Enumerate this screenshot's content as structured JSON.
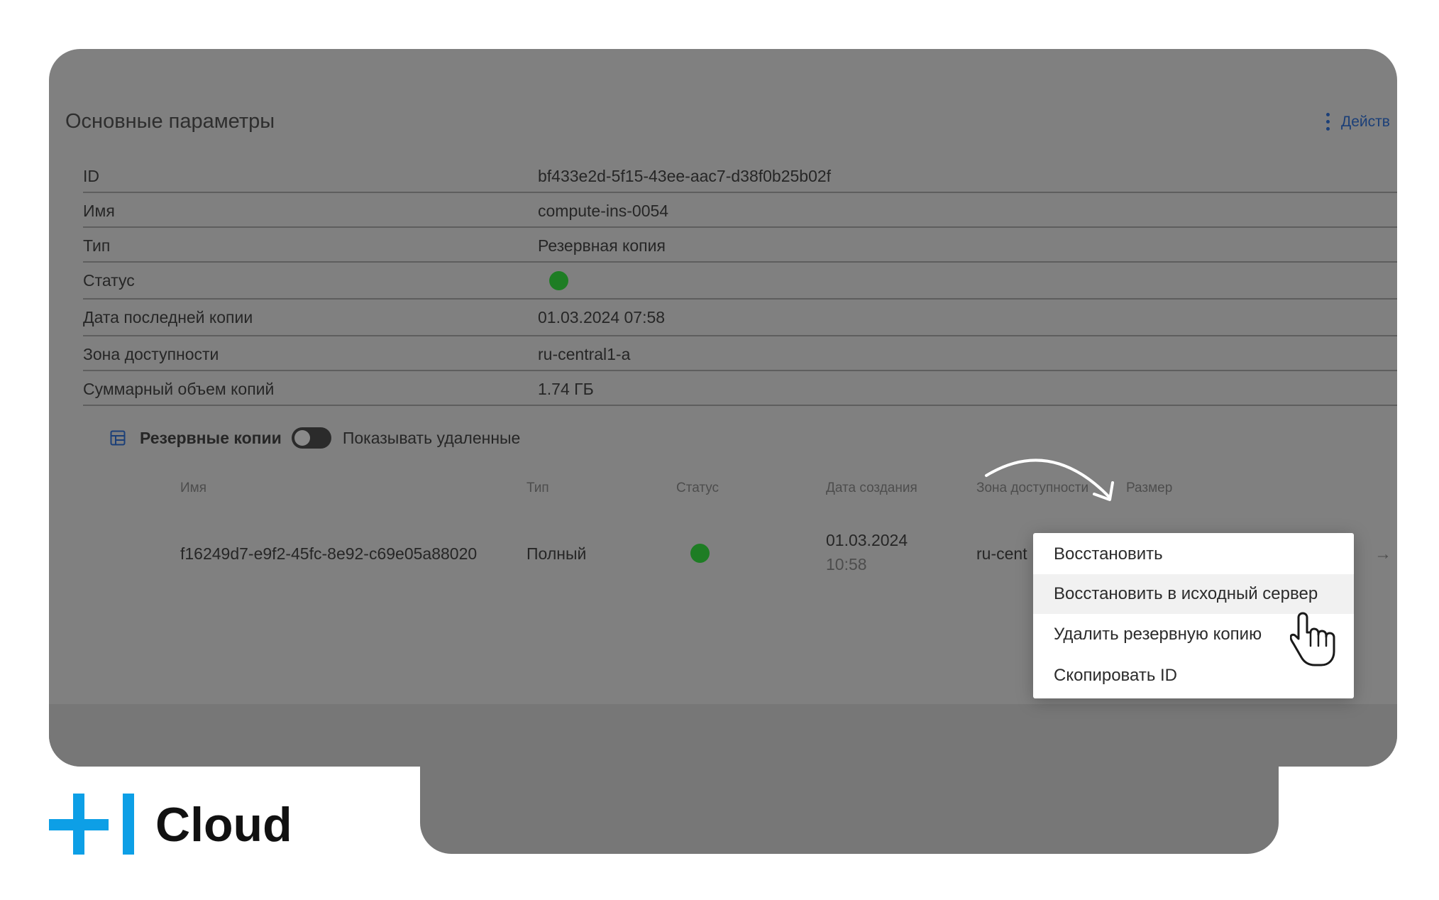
{
  "header": {
    "title": "Основные параметры",
    "actions_label": "Действ"
  },
  "properties": [
    {
      "label": "ID",
      "value": "bf433e2d-5f15-43ee-aac7-d38f0b25b02f"
    },
    {
      "label": "Имя",
      "value": "compute-ins-0054"
    },
    {
      "label": "Тип",
      "value": "Резервная копия"
    },
    {
      "label": "Статус",
      "value": "",
      "status_color": "#1e7d24"
    },
    {
      "label": "Дата последней копии",
      "value": "01.03.2024 07:58"
    },
    {
      "label": "Зона доступности",
      "value": "ru-central1-a"
    },
    {
      "label": "Суммарный объем копий",
      "value": "1.74 ГБ"
    }
  ],
  "backups": {
    "title": "Резервные копии",
    "toggle_label": "Показывать удаленные",
    "toggle_on": false,
    "columns": {
      "name": "Имя",
      "type": "Тип",
      "status": "Статус",
      "created": "Дата создания",
      "zone": "Зона доступности",
      "size": "Размер"
    },
    "rows": [
      {
        "name": "f16249d7-e9f2-45fc-8e92-c69e05a88020",
        "type": "Полный",
        "status_color": "#1e7d24",
        "created_date": "01.03.2024",
        "created_time": "10:58",
        "zone": "ru-cent"
      }
    ]
  },
  "context_menu": {
    "items": [
      {
        "label": "Восстановить"
      },
      {
        "label": "Восстановить в исходный сервер"
      },
      {
        "label": "Удалить резервную копию"
      },
      {
        "label": "Скопировать ID"
      }
    ],
    "hovered_index": 1
  },
  "brand": {
    "name": "Cloud",
    "accent_color": "#0d9fe6"
  }
}
